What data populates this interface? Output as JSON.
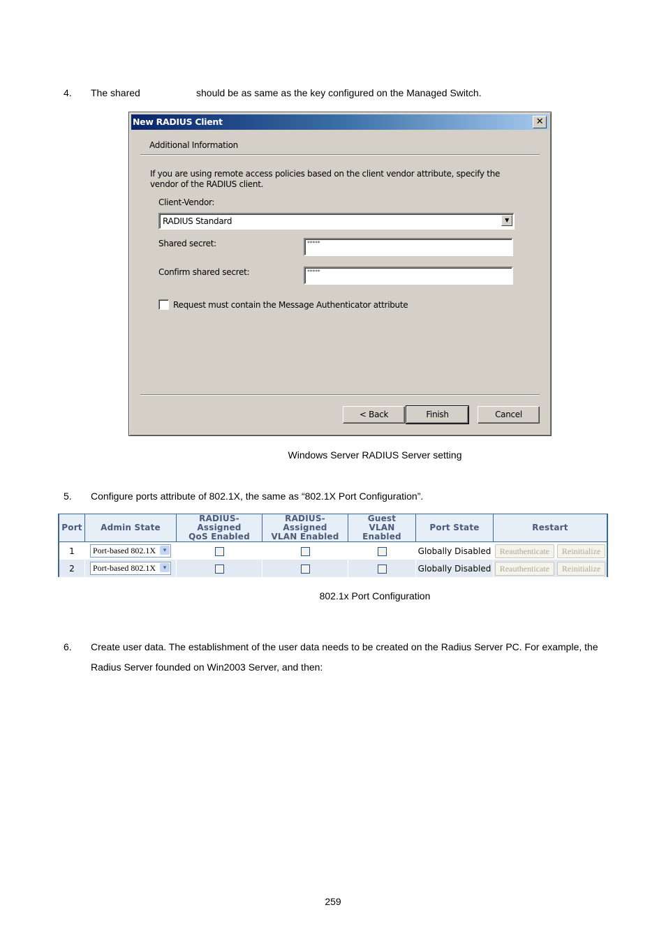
{
  "step4": {
    "number": "4.",
    "text_before": "The shared",
    "text_after": "should be as same as the key configured on the Managed Switch."
  },
  "dialog": {
    "title": "New RADIUS Client",
    "section_title": "Additional Information",
    "description": "If you are using remote access policies based on the client vendor attribute, specify the vendor of the RADIUS client.",
    "client_vendor_label": "Client-Vendor:",
    "client_vendor_value": "RADIUS Standard",
    "shared_secret_label": "Shared secret:",
    "shared_secret_value": "*****",
    "confirm_secret_label": "Confirm shared secret:",
    "confirm_secret_value": "*****",
    "checkbox_label": "Request must contain the Message Authenticator attribute",
    "checkbox_checked": false,
    "buttons": {
      "back": "< Back",
      "finish": "Finish",
      "cancel": "Cancel"
    },
    "close_glyph": "✕"
  },
  "caption1": "Windows Server RADIUS Server setting",
  "step5": {
    "number": "5.",
    "text": "Configure ports attribute of 802.1X, the same as “802.1X Port Configuration”."
  },
  "port_table": {
    "headers": [
      "Port",
      "Admin State",
      "RADIUS-Assigned QoS Enabled",
      "RADIUS-Assigned VLAN Enabled",
      "Guest VLAN Enabled",
      "Port State",
      "Restart"
    ],
    "header_lines": {
      "qos": [
        "RADIUS-Assigned",
        "QoS Enabled"
      ],
      "vlan": [
        "RADIUS-Assigned",
        "VLAN Enabled"
      ],
      "guest": [
        "Guest",
        "VLAN Enabled"
      ]
    },
    "rows": [
      {
        "port": "1",
        "admin_state": "Port-based 802.1X",
        "qos": false,
        "vlan": false,
        "guest": false,
        "port_state": "Globally Disabled",
        "reauth": "Reauthenticate",
        "reinit": "Reinitialize"
      },
      {
        "port": "2",
        "admin_state": "Port-based 802.1X",
        "qos": false,
        "vlan": false,
        "guest": false,
        "port_state": "Globally Disabled",
        "reauth": "Reauthenticate",
        "reinit": "Reinitialize"
      }
    ]
  },
  "caption2": "802.1x Port Configuration",
  "step6": {
    "number": "6.",
    "line1": "Create user data. The establishment of the user data needs to be created on the Radius Server PC. For example, the",
    "line2": "Radius Server founded on Win2003 Server, and then:"
  },
  "page_number": "259"
}
